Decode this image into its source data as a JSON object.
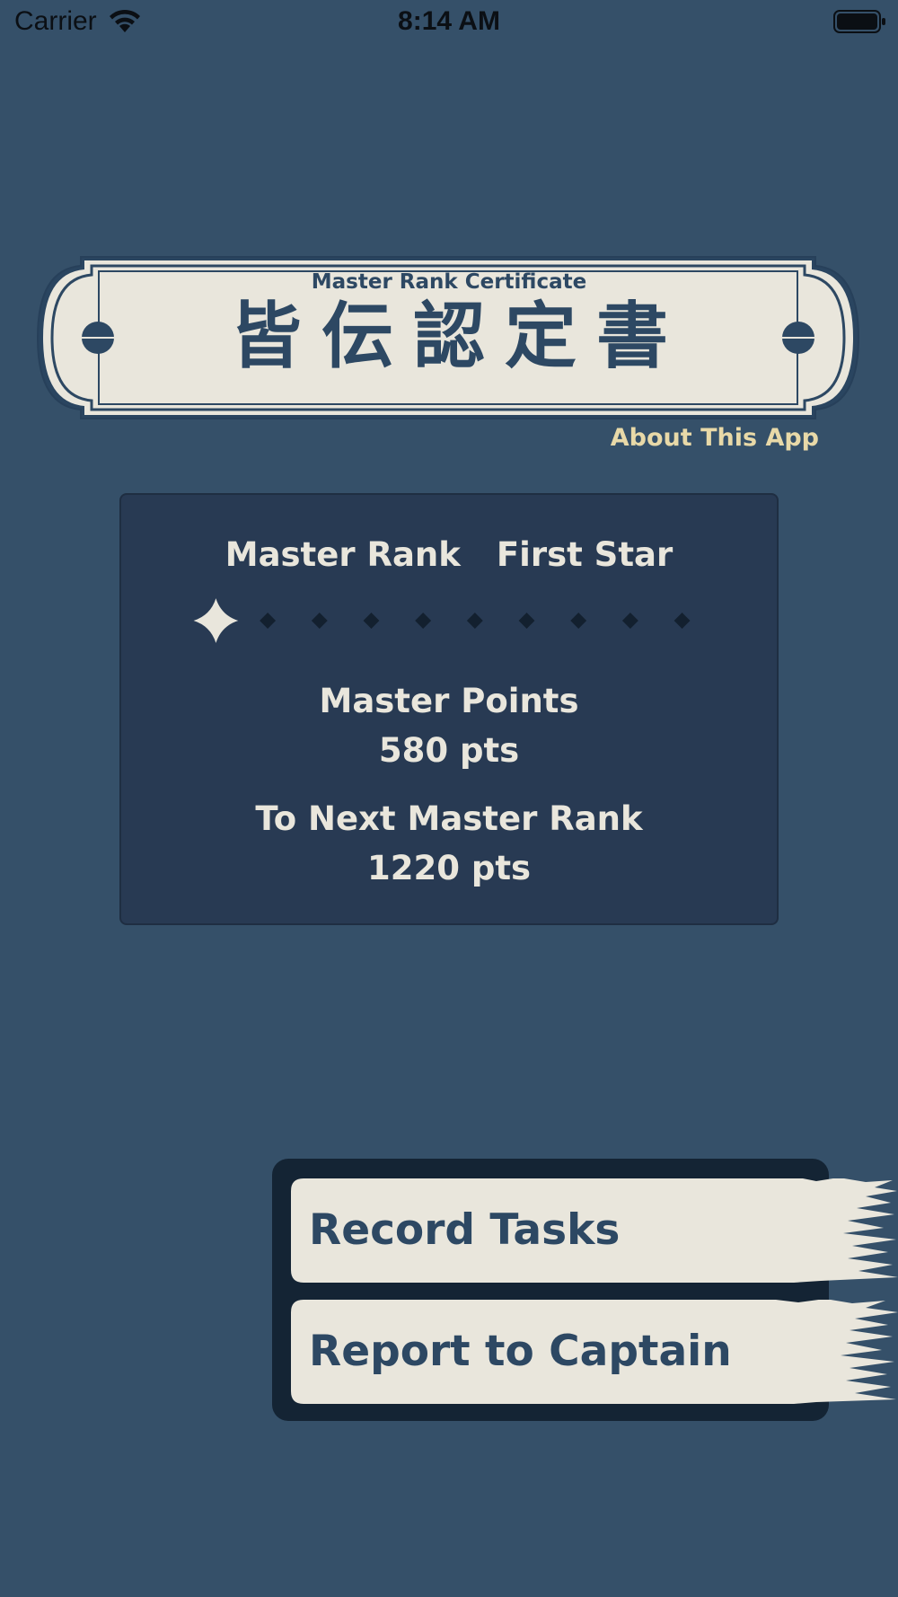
{
  "status_bar": {
    "carrier": "Carrier",
    "time": "8:14 AM"
  },
  "header": {
    "subtitle": "Master Rank Certificate",
    "title": "皆伝認定書",
    "about_link": "About This App"
  },
  "rank_card": {
    "rank_label": "Master Rank",
    "rank_value": "First Star",
    "stars_earned": 1,
    "stars_total": 10,
    "points_label": "Master Points",
    "points_value": "580 pts",
    "next_label": "To Next Master Rank",
    "next_value": "1220 pts"
  },
  "menu": {
    "record_tasks": "Record Tasks",
    "report_to_captain": "Report to Captain"
  },
  "colors": {
    "background": "#355069",
    "panel": "#283a53",
    "cream": "#e9e6dc",
    "navy_text": "#2d4863",
    "link_gold": "#e8d9a8",
    "menu_dark": "#142434"
  },
  "icons": [
    "wifi-icon",
    "battery-icon",
    "four-point-star-icon",
    "diamond-icon"
  ]
}
